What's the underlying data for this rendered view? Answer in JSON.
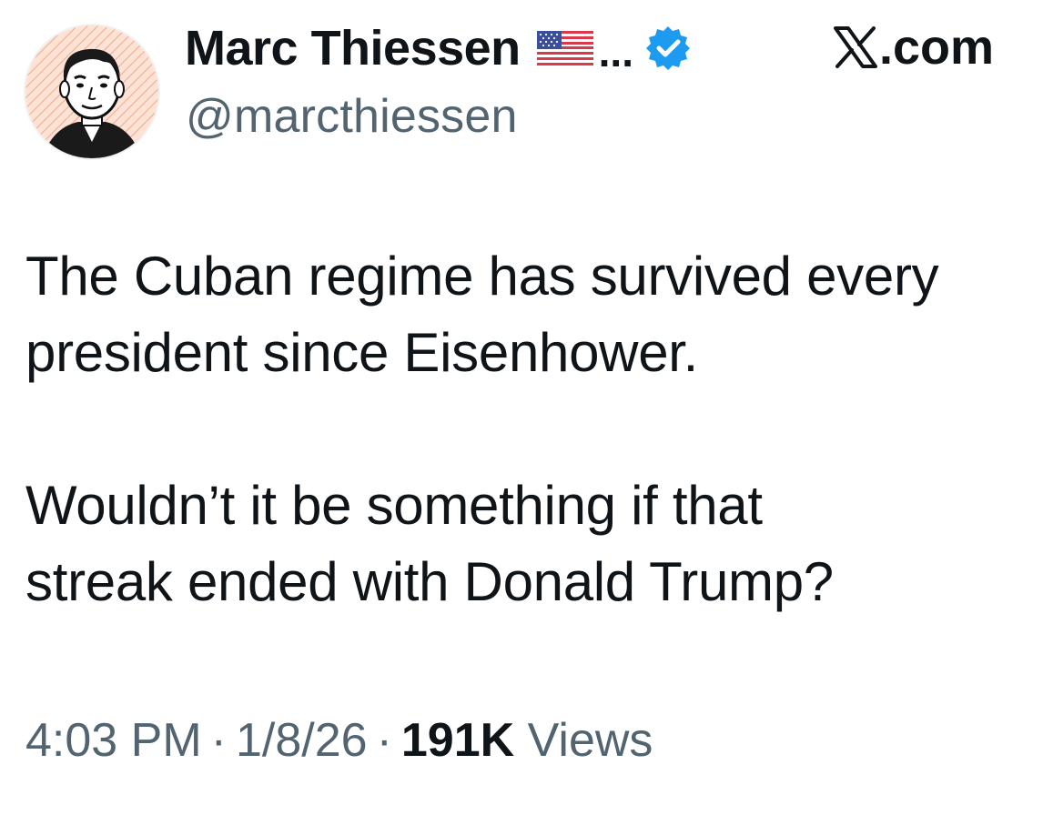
{
  "author": {
    "display_name": "Marc Thiessen",
    "truncation": "...",
    "handle": "@marcthiessen",
    "avatar_icon": "cartoon-portrait-avatar",
    "flag_icon": "us-flag-emoji",
    "verified_icon": "verified-badge-icon",
    "verified_color": "#1d9bf0"
  },
  "brand": {
    "label": ".com",
    "icon": "x-logo-icon"
  },
  "tweet": {
    "lines_para1": [
      "The Cuban regime has survived every",
      "president since Eisenhower."
    ],
    "lines_para2": [
      "Wouldn’t it be something if that",
      "streak ended with Donald Trump?"
    ]
  },
  "meta": {
    "time": "4:03 PM",
    "separator": "·",
    "date": "1/8/26",
    "views_count": "191K",
    "views_label": "Views"
  },
  "colors": {
    "text_primary": "#0f1419",
    "text_secondary": "#536471",
    "accent": "#1d9bf0"
  }
}
